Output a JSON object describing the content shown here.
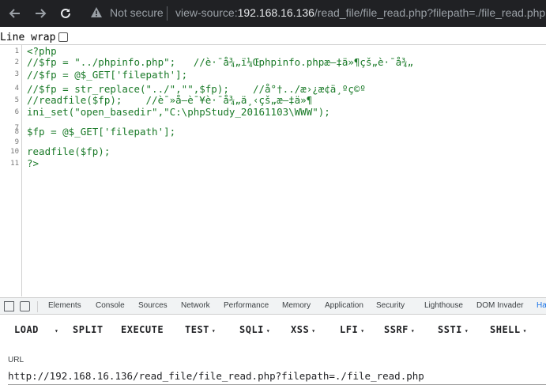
{
  "browser": {
    "not_secure": "Not secure",
    "url_scheme": "view-source:",
    "url_host": "192.168.16.136",
    "url_path": "/read_file/file_read.php?filepath=./file_read.php"
  },
  "linewrap": {
    "label": "Line wrap"
  },
  "source": {
    "line_numbers": [
      "1",
      "2",
      "3",
      "4",
      "5",
      "6",
      "7",
      "8",
      "9",
      "10",
      "11"
    ],
    "lines": [
      "<?php",
      "//$fp = \"../phpinfo.php\";   //è·¯å¾„ï¼Œphpinfo.phpæ–‡ä»¶çš„è·¯å¾„",
      "//$fp = @$_GET['filepath'];",
      "//$fp = str_replace(\"../\",\"\",$fp);    //å°†../æ›¿æ¢ä¸ºç©º",
      "//readfile($fp);    //è¯»å–è¯¥è·¯å¾„ä¸‹çš„æ–‡ä»¶",
      "ini_set(\"open_basedir\",\"C:\\phpStudy_20161103\\WWW\");",
      "",
      "$fp = @$_GET['filepath'];",
      "",
      "readfile($fp);",
      "?>"
    ]
  },
  "devtools": {
    "tabs": [
      "Elements",
      "Console",
      "Sources",
      "Network",
      "Performance",
      "Memory",
      "Application",
      "Security",
      "Lighthouse",
      "DOM Invader",
      "Ha"
    ]
  },
  "hackbar": {
    "load": "LOAD",
    "split": "SPLIT",
    "execute": "EXECUTE",
    "test": "TEST",
    "sqli": "SQLI",
    "xss": "XSS",
    "lfi": "LFI",
    "ssrf": "SSRF",
    "ssti": "SSTI",
    "shell": "SHELL",
    "caret": "▾"
  },
  "url_section": {
    "label": "URL",
    "value": "http://192.168.16.136/read_file/file_read.php?filepath=./file_read.php"
  }
}
